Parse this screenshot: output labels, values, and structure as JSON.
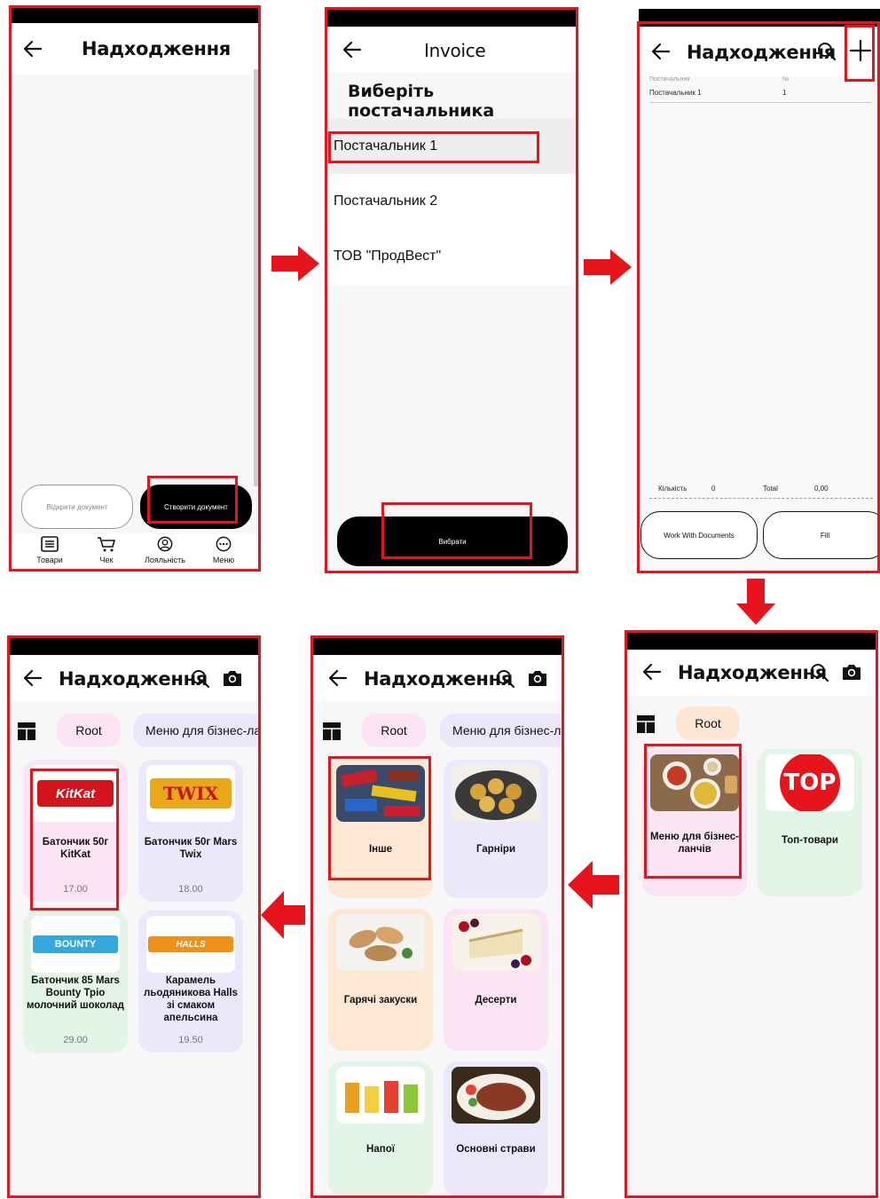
{
  "colors": {
    "highlight": "#e8141c",
    "dark_button": "#000000",
    "pink_card": "#fbe4f4",
    "lavender_card": "#ece8fb",
    "mint_card": "#e2f5e6",
    "peach_card": "#fde8d4"
  },
  "screen1": {
    "title": "Надходження",
    "open_doc_button": "Відкрити документ",
    "create_doc_button": "Створити документ",
    "nav": [
      {
        "label": "Товари",
        "icon": "list-icon"
      },
      {
        "label": "Чек",
        "icon": "cart-icon"
      },
      {
        "label": "Лояльність",
        "icon": "person-icon"
      },
      {
        "label": "Меню",
        "icon": "more-icon"
      }
    ]
  },
  "screen2": {
    "title": "Invoice",
    "subtitle": "Виберіть постачальника",
    "suppliers": [
      "Постачальник 1",
      "Постачальник 2",
      "ТОВ \"ПродВест\""
    ],
    "select_button": "Вибрати"
  },
  "screen3": {
    "title": "Надходження",
    "col_supplier": "Постачальник",
    "col_number": "№",
    "row_supplier": "Постачальник 1",
    "row_number": "1",
    "qty_label": "Кількість",
    "qty_value": "0",
    "total_label": "Total",
    "total_value": "0,00",
    "work_button": "Work With Documents",
    "fill_button": "Fill"
  },
  "screen4": {
    "title": "Надходження",
    "chip_root": "Root",
    "categories": [
      {
        "name": "Меню для бізнес-ланчів",
        "image": "food-plate-image"
      },
      {
        "name": "Топ-товари",
        "badge": "TOP"
      }
    ]
  },
  "screen5": {
    "title": "Надходження",
    "chip_root": "Root",
    "chip_menu": "Меню для бізнес-ла",
    "categories": [
      "Інше",
      "Гарніри",
      "Гарячі закуски",
      "Десерти",
      "Напої",
      "Основні страви"
    ]
  },
  "screen6": {
    "title": "Надходження",
    "chip_root": "Root",
    "chip_menu": "Меню для бізнес-ла",
    "products": [
      {
        "name": "Батончик 50г KitKat",
        "price": "17.00",
        "logo": "KitKat"
      },
      {
        "name": "Батончик 50г Mars Twix",
        "price": "18.00",
        "logo": "TWIX"
      },
      {
        "name": "Батончик 85 Mars Bounty Тріо молочний шоколад",
        "price": "29.00",
        "logo": "BOUNTY"
      },
      {
        "name": "Карамель льодяникова Halls зі смаком апельсина",
        "price": "19.50",
        "logo": "HALLS"
      }
    ]
  }
}
